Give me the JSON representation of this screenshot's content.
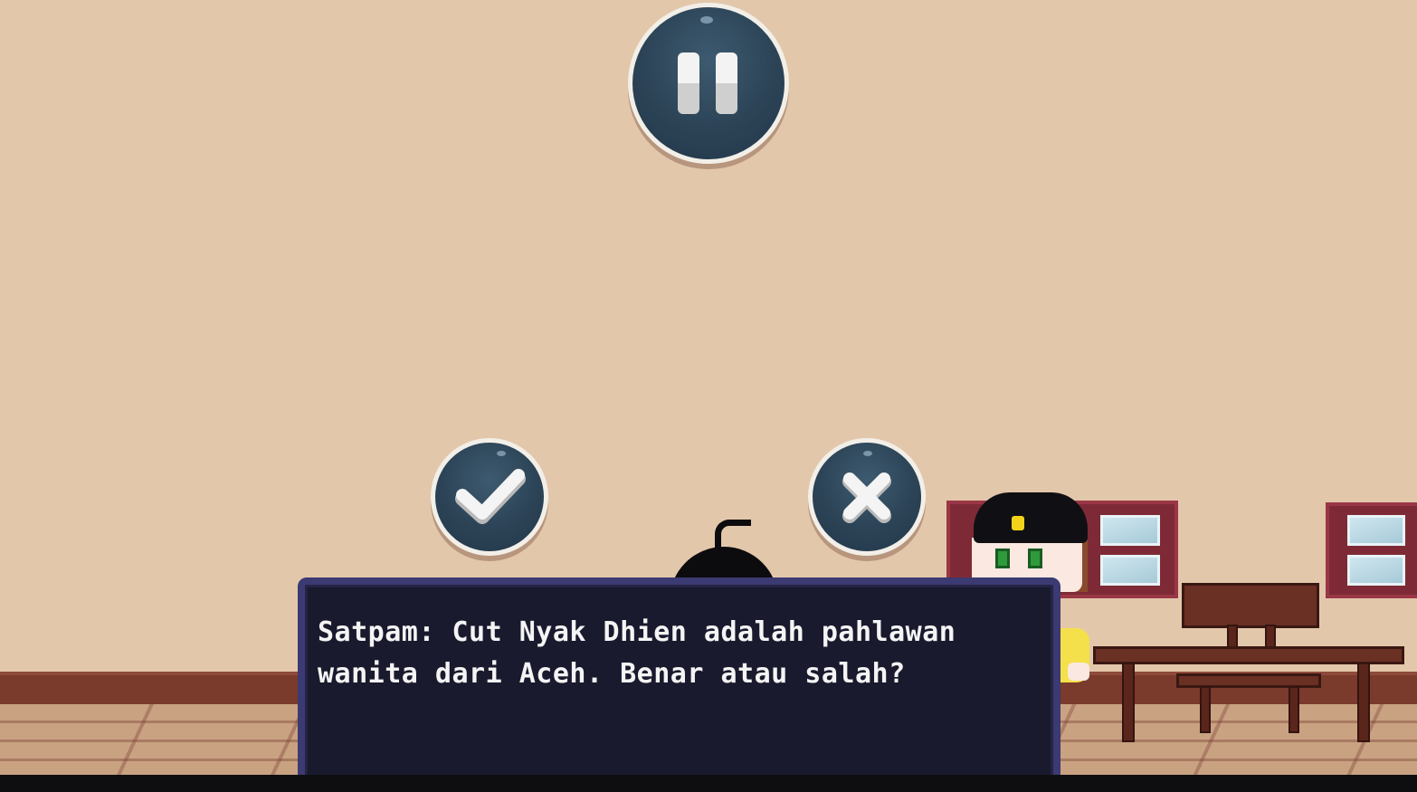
{
  "hud": {
    "pause_button": {
      "icon": "pause-icon"
    },
    "answer_true_button": {
      "icon": "check-icon"
    },
    "answer_false_button": {
      "icon": "close-icon"
    }
  },
  "dialog": {
    "text": "Satpam: Cut Nyak Dhien adalah pahlawan\nwanita dari Aceh. Benar atau salah?"
  },
  "colors": {
    "wall": "#e3c7ab",
    "button_fill": "#2c4356",
    "button_border": "#f2efe8",
    "dialog_fill": "#1a1a2e",
    "dialog_border": "#3b3a72",
    "dialog_text": "#f4f4f4"
  }
}
